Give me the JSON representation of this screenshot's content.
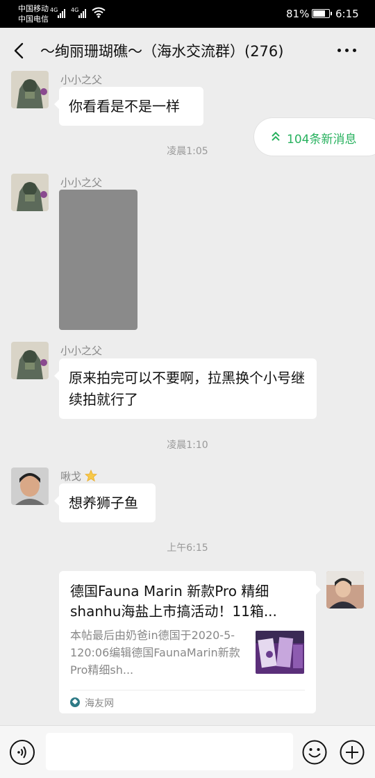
{
  "status_bar": {
    "carrier_1": "中国移动",
    "carrier_2": "中国电信",
    "network_1": "4G",
    "network_2": "4G",
    "battery_percent": "81%",
    "battery_level": 0.81,
    "time": "6:15"
  },
  "header": {
    "title": "～绚丽珊瑚礁～（海水交流群）(276)",
    "back_icon": "chevron-left-icon",
    "more_icon": "more-dots-icon"
  },
  "new_messages_pill": {
    "label": "104条新消息",
    "icon": "double-chevron-up-icon"
  },
  "timestamps": [
    "凌晨1:05",
    "凌晨1:10",
    "上午6:15"
  ],
  "messages": [
    {
      "sender": "小小之父",
      "text": "你看看是不是一样"
    },
    {
      "sender": "小小之父",
      "type": "image"
    },
    {
      "sender": "小小之父",
      "text": "原来拍完可以不要啊，拉黑换个小号继续拍就行了"
    },
    {
      "sender": "啾戈",
      "sender_badge": "star-icon",
      "text": "想养狮子鱼"
    },
    {
      "sender": "self",
      "type": "link",
      "title": "德国Fauna Marin 新款Pro 精细shanhu海盐上市搞活动！11箱...",
      "description": "本帖最后由奶爸in德国于2020-5-120:06编辑德国FaunaMarin新款Pro精细sh...",
      "source": "海友网"
    }
  ],
  "input_bar": {
    "voice_icon": "voice-icon",
    "emoji_icon": "emoji-icon",
    "plus_icon": "plus-icon",
    "text_value": ""
  },
  "colors": {
    "background": "#ededed",
    "accent_green": "#27b15e",
    "bubble": "#ffffff",
    "muted_text": "#888888"
  }
}
